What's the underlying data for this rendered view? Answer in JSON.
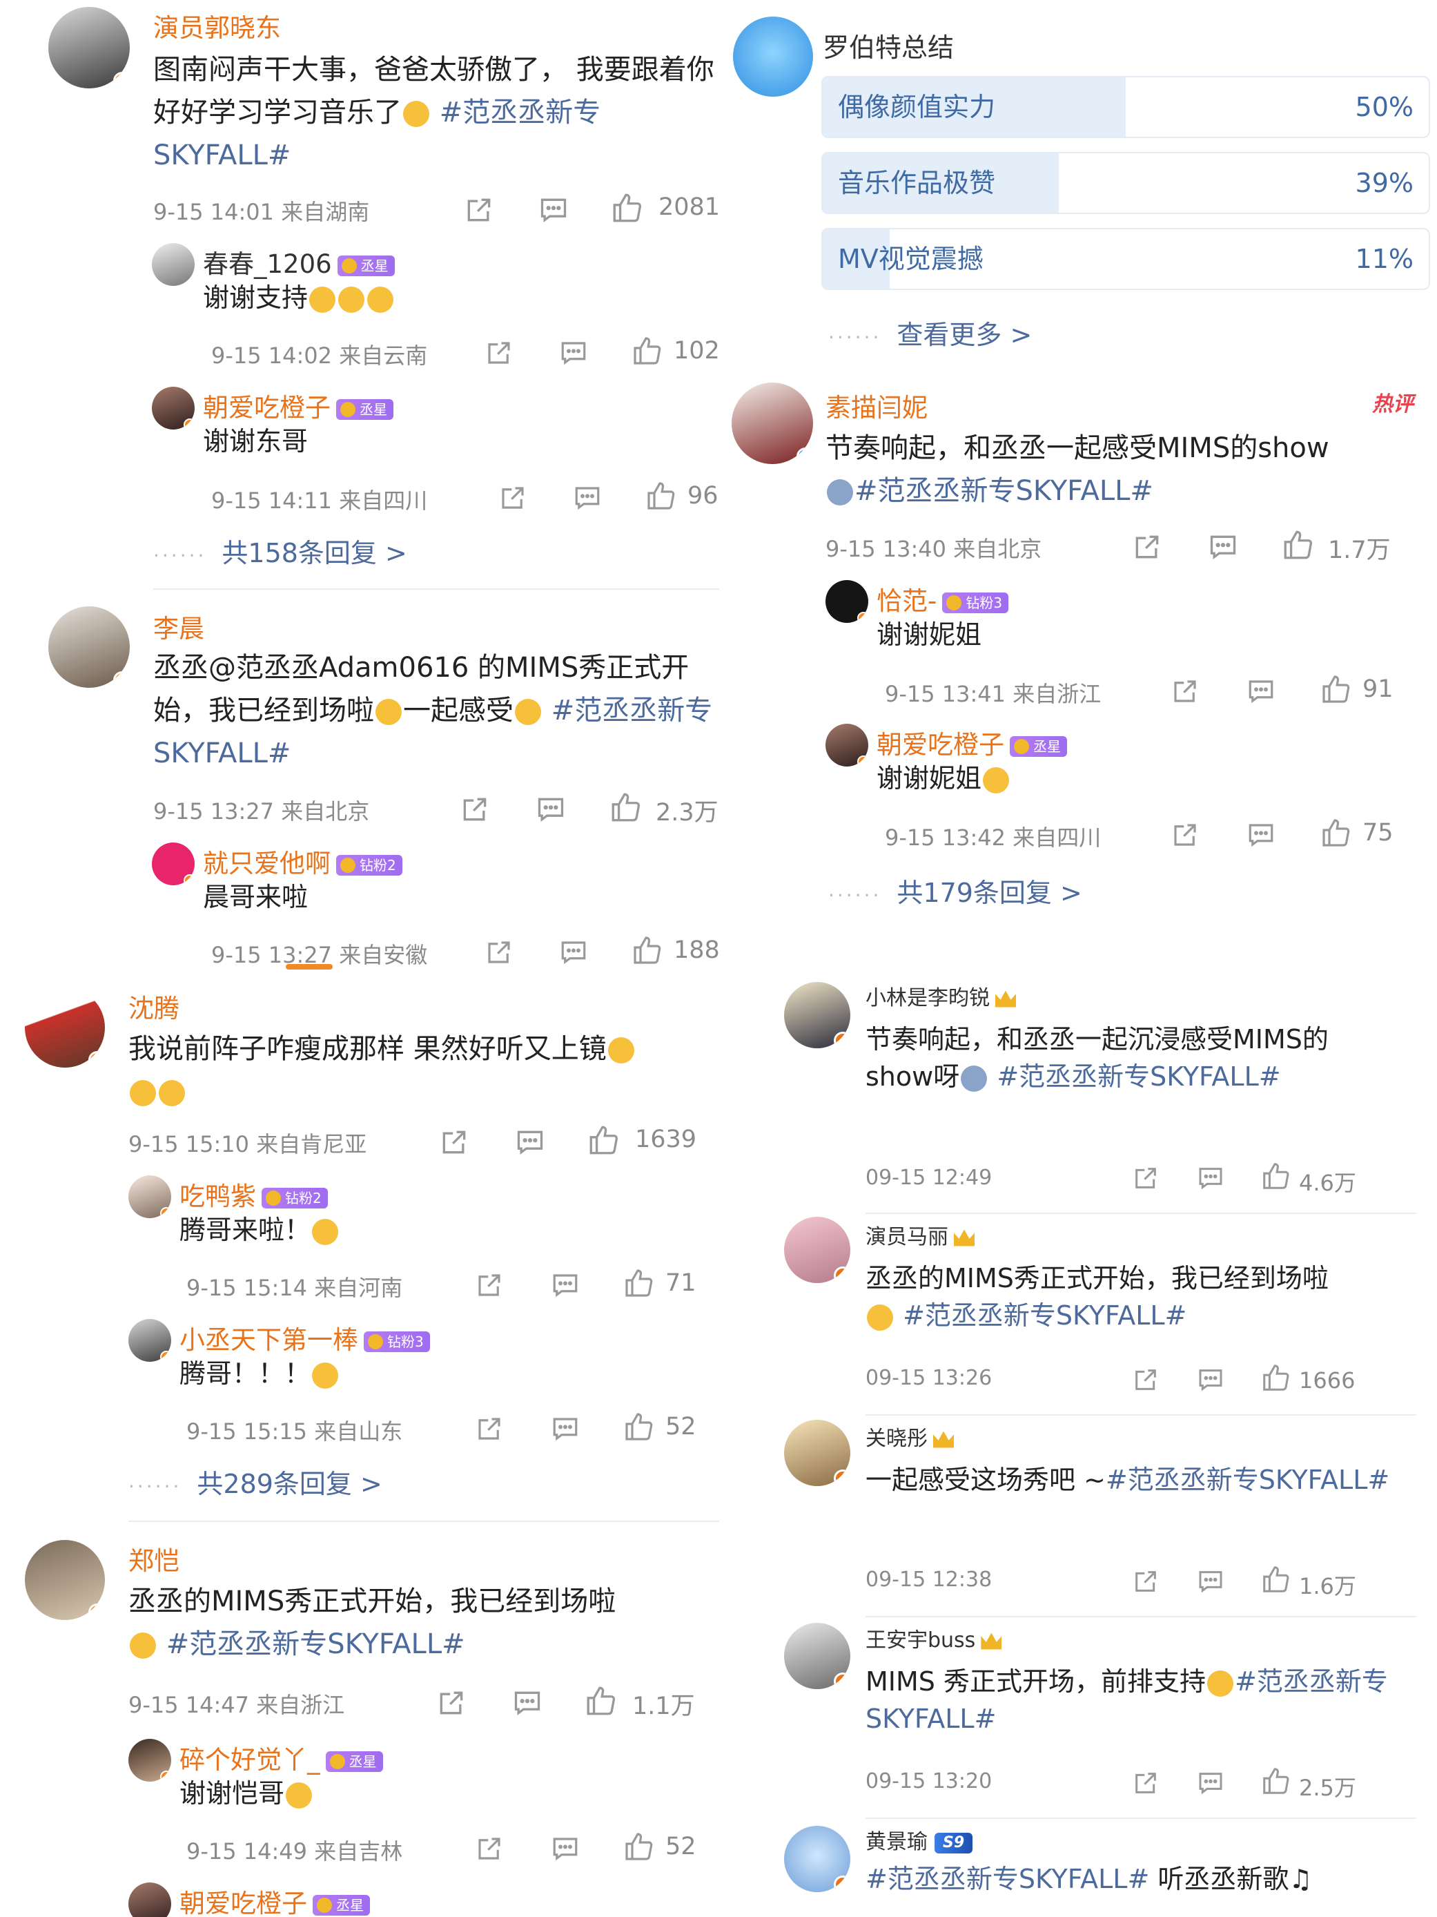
{
  "panel_tl": {
    "posts": [
      {
        "name": "演员郭晓东",
        "body_text": "图南闷声干大事，爸爸太骄傲了， 我要跟着你好好学习学习音乐了",
        "tag": "#范丞丞新专SKYFALL#",
        "meta": "9-15 14:01 来自湖南",
        "likes": "2081",
        "replies": [
          {
            "name": "春春_1206",
            "badge": "丞星",
            "text": "谢谢支持",
            "meta": "9-15 14:02 来自云南",
            "likes": "102"
          },
          {
            "name": "朝爱吃橙子",
            "badge": "丞星",
            "text": "谢谢东哥",
            "meta": "9-15 14:11 来自四川",
            "likes": "96"
          }
        ],
        "more": "共158条回复 >"
      },
      {
        "name": "李晨",
        "body_text": "丞丞@范丞丞Adam0616 的MIMS秀正式开始，我已经到场啦",
        "body_text2": "一起感受",
        "tag": "#范丞丞新专SKYFALL#",
        "meta": "9-15 13:27 来自北京",
        "likes": "2.3万",
        "replies": [
          {
            "name": "就只爱他啊",
            "badge": "钻粉2",
            "text": "晨哥来啦",
            "meta": "9-15 13:27 来自安徽",
            "likes": "188"
          }
        ]
      }
    ]
  },
  "panel_tr": {
    "poll_title": "罗伯特总结",
    "poll": [
      {
        "label": "偶像颜值实力",
        "pct": "50%",
        "value": 50
      },
      {
        "label": "音乐作品极赞",
        "pct": "39%",
        "value": 39
      },
      {
        "label": "MV视觉震撼",
        "pct": "11%",
        "value": 11
      }
    ],
    "poll_more": "查看更多 >",
    "post": {
      "name": "素描闫妮",
      "hot": "热评",
      "body_text": "节奏响起，和丞丞一起感受MIMS的show",
      "tag": "#范丞丞新专SKYFALL#",
      "meta": "9-15 13:40 来自北京",
      "likes": "1.7万",
      "replies": [
        {
          "name": "恰范-",
          "badge": "钻粉3",
          "text": "谢谢妮姐",
          "meta": "9-15 13:41 来自浙江",
          "likes": "91"
        },
        {
          "name": "朝爱吃橙子",
          "badge": "丞星",
          "text": "谢谢妮姐",
          "meta": "9-15 13:42 来自四川",
          "likes": "75"
        }
      ],
      "more": "共179条回复 >"
    }
  },
  "panel_bl": {
    "posts": [
      {
        "name": "沈腾",
        "body_text": "我说前阵子咋瘦成那样 果然好听又上镜",
        "meta": "9-15 15:10 来自肯尼亚",
        "likes": "1639",
        "replies": [
          {
            "name": "吃鸭紫",
            "badge": "钻粉2",
            "text": "腾哥来啦！",
            "meta": "9-15 15:14 来自河南",
            "likes": "71"
          },
          {
            "name": "小丞天下第一棒",
            "badge": "钻粉3",
            "text": "腾哥！！！",
            "meta": "9-15 15:15 来自山东",
            "likes": "52"
          }
        ],
        "more": "共289条回复 >"
      },
      {
        "name": "郑恺",
        "body_text": "丞丞的MIMS秀正式开始，我已经到场啦",
        "tag": "#范丞丞新专SKYFALL#",
        "meta": "9-15 14:47 来自浙江",
        "likes": "1.1万",
        "replies": [
          {
            "name": "碎个好觉丫_",
            "badge": "丞星",
            "text": "谢谢恺哥",
            "meta": "9-15 14:49 来自吉林",
            "likes": "52"
          },
          {
            "name": "朝爱吃橙子",
            "badge": "丞星"
          }
        ]
      }
    ]
  },
  "panel_br": {
    "posts": [
      {
        "name": "小林是李昀锐",
        "body_text": "节奏响起，和丞丞一起沉浸感受MIMS的show呀",
        "tag": "#范丞丞新专SKYFALL#",
        "meta": "09-15 12:49",
        "likes": "4.6万"
      },
      {
        "name": "演员马丽",
        "body_text": "丞丞的MIMS秀正式开始，我已经到场啦",
        "tag": "#范丞丞新专SKYFALL#",
        "meta": "09-15 13:26",
        "likes": "1666"
      },
      {
        "name": "关晓彤",
        "body_text": "一起感受这场秀吧 ~",
        "tag": "#范丞丞新专SKYFALL#",
        "meta": "09-15 12:38",
        "likes": "1.6万"
      },
      {
        "name": "王安宇buss",
        "body_text": "MIMS 秀正式开场，前排支持",
        "tag": "#范丞丞新专 SKYFALL#",
        "meta": "09-15 13:20",
        "likes": "2.5万"
      },
      {
        "name": "黄景瑜",
        "badge": "S9",
        "body_text": "听丞丞新歌",
        "tag": "#范丞丞新专SKYFALL#"
      }
    ]
  },
  "colors": {
    "name": "#e8731b",
    "link": "#4d6a9d",
    "meta": "#8a8a8a",
    "verified": "#f08a24",
    "poll_fill": "#e3eef9"
  },
  "icons": {
    "share": "share-icon",
    "comment": "comment-icon",
    "like": "thumbs-up-icon",
    "badge": "fan-badge-icon",
    "crown": "crown-icon",
    "verified": "verified-badge-icon"
  }
}
